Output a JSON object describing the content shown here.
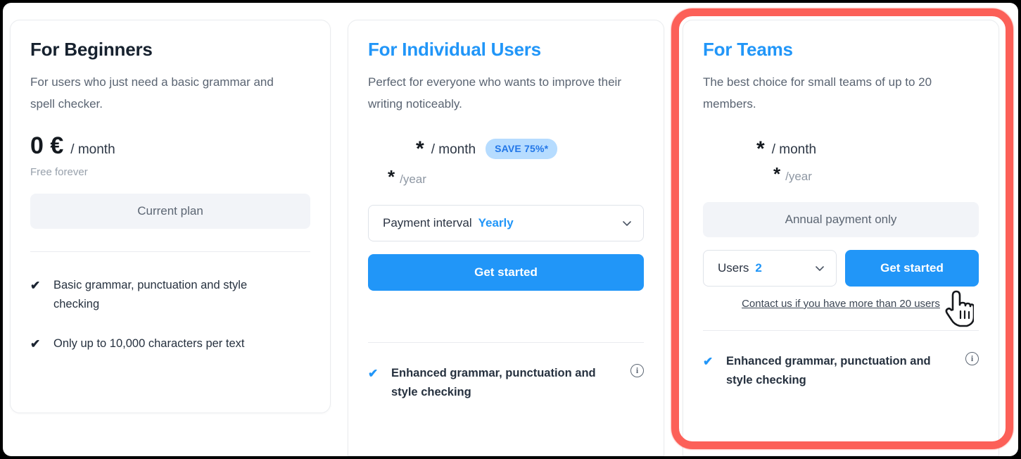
{
  "theme": {
    "accent_blue": "#2196f8",
    "highlight_red": "#fc6058",
    "badge_bg": "#b6dcff",
    "muted_button_bg": "#f2f4f8",
    "text_dark": "#16212e",
    "text_muted": "#5a6472"
  },
  "plans": [
    {
      "id": "beginners",
      "title": "For Beginners",
      "description": "For users who just need a basic grammar and spell checker.",
      "price_amount": "0 €",
      "price_unit": "/ month",
      "price_sub": "Free forever",
      "action_label": "Current plan",
      "features": [
        {
          "tick": "✔",
          "text": "Basic grammar, punctuation and style checking",
          "info": false
        },
        {
          "tick": "✔",
          "text": "Only up to 10,000 characters per text",
          "info": false
        }
      ]
    },
    {
      "id": "individual",
      "title": "For Individual Users",
      "description": "Perfect for everyone who wants to improve their writing noticeably.",
      "price_amount": "*",
      "price_unit": "/ month",
      "badge": "SAVE 75%*",
      "year_amount": "*",
      "year_unit": "/year",
      "interval_label": "Payment interval",
      "interval_value": "Yearly",
      "chevron": "chevron-down-icon",
      "cta_label": "Get started",
      "features": [
        {
          "tick": "✔",
          "text": "Enhanced grammar, punctuation and style checking",
          "info": true,
          "info_glyph": "i"
        }
      ]
    },
    {
      "id": "teams",
      "title": "For Teams",
      "description": "The best choice for small teams of up to 20 members.",
      "price_amount": "*",
      "price_unit": "/ month",
      "year_amount": "*",
      "year_unit": "/year",
      "payment_note": "Annual payment only",
      "users_label": "Users",
      "users_value": "2",
      "chevron": "chevron-down-icon",
      "cta_label": "Get started",
      "contact_link": "Contact us if you have more than 20 users",
      "features": [
        {
          "tick": "✔",
          "text": "Enhanced grammar, punctuation and style checking",
          "info": true,
          "info_glyph": "i"
        }
      ],
      "highlighted": true
    }
  ],
  "cursor": {
    "type": "pointer-hand-cursor"
  }
}
